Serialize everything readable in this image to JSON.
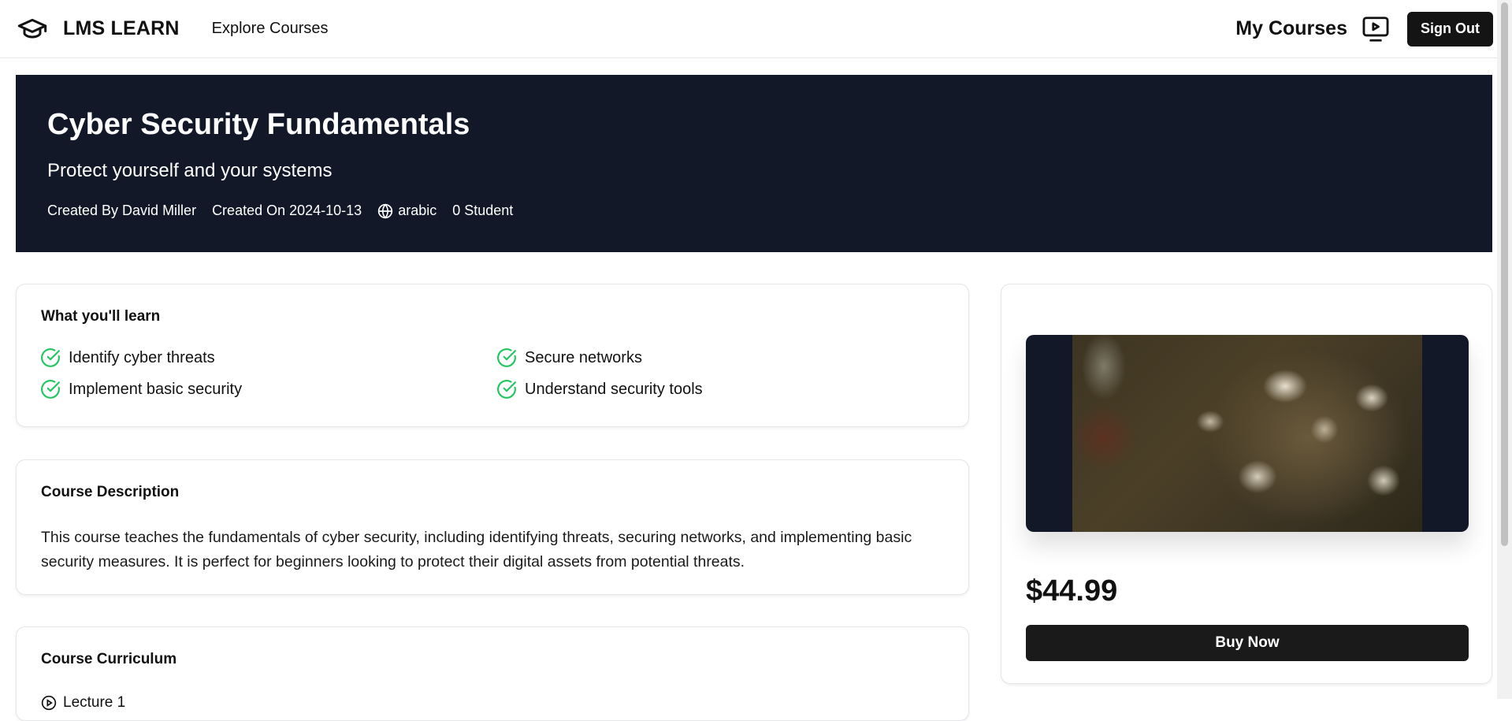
{
  "header": {
    "brand": "LMS LEARN",
    "nav_explore": "Explore Courses",
    "my_courses": "My Courses",
    "sign_out": "Sign Out"
  },
  "hero": {
    "title": "Cyber Security Fundamentals",
    "subtitle": "Protect yourself and your systems",
    "created_by": "Created By David Miller",
    "created_on": "Created On 2024-10-13",
    "language": "arabic",
    "students": "0 Student"
  },
  "learn": {
    "title": "What you'll learn",
    "items": [
      "Identify cyber threats",
      "Secure networks",
      "Implement basic security",
      "Understand security tools"
    ]
  },
  "description": {
    "title": "Course Description",
    "text": "This course teaches the fundamentals of cyber security, including identifying threats, securing networks, and implementing basic security measures. It is perfect for beginners looking to protect their digital assets from potential threats."
  },
  "curriculum": {
    "title": "Course Curriculum",
    "first_lecture": "Lecture 1"
  },
  "purchase": {
    "price": "$44.99",
    "buy_label": "Buy Now"
  },
  "colors": {
    "hero_bg": "#121827",
    "check_green": "#22c55e",
    "button_dark": "#141414"
  }
}
